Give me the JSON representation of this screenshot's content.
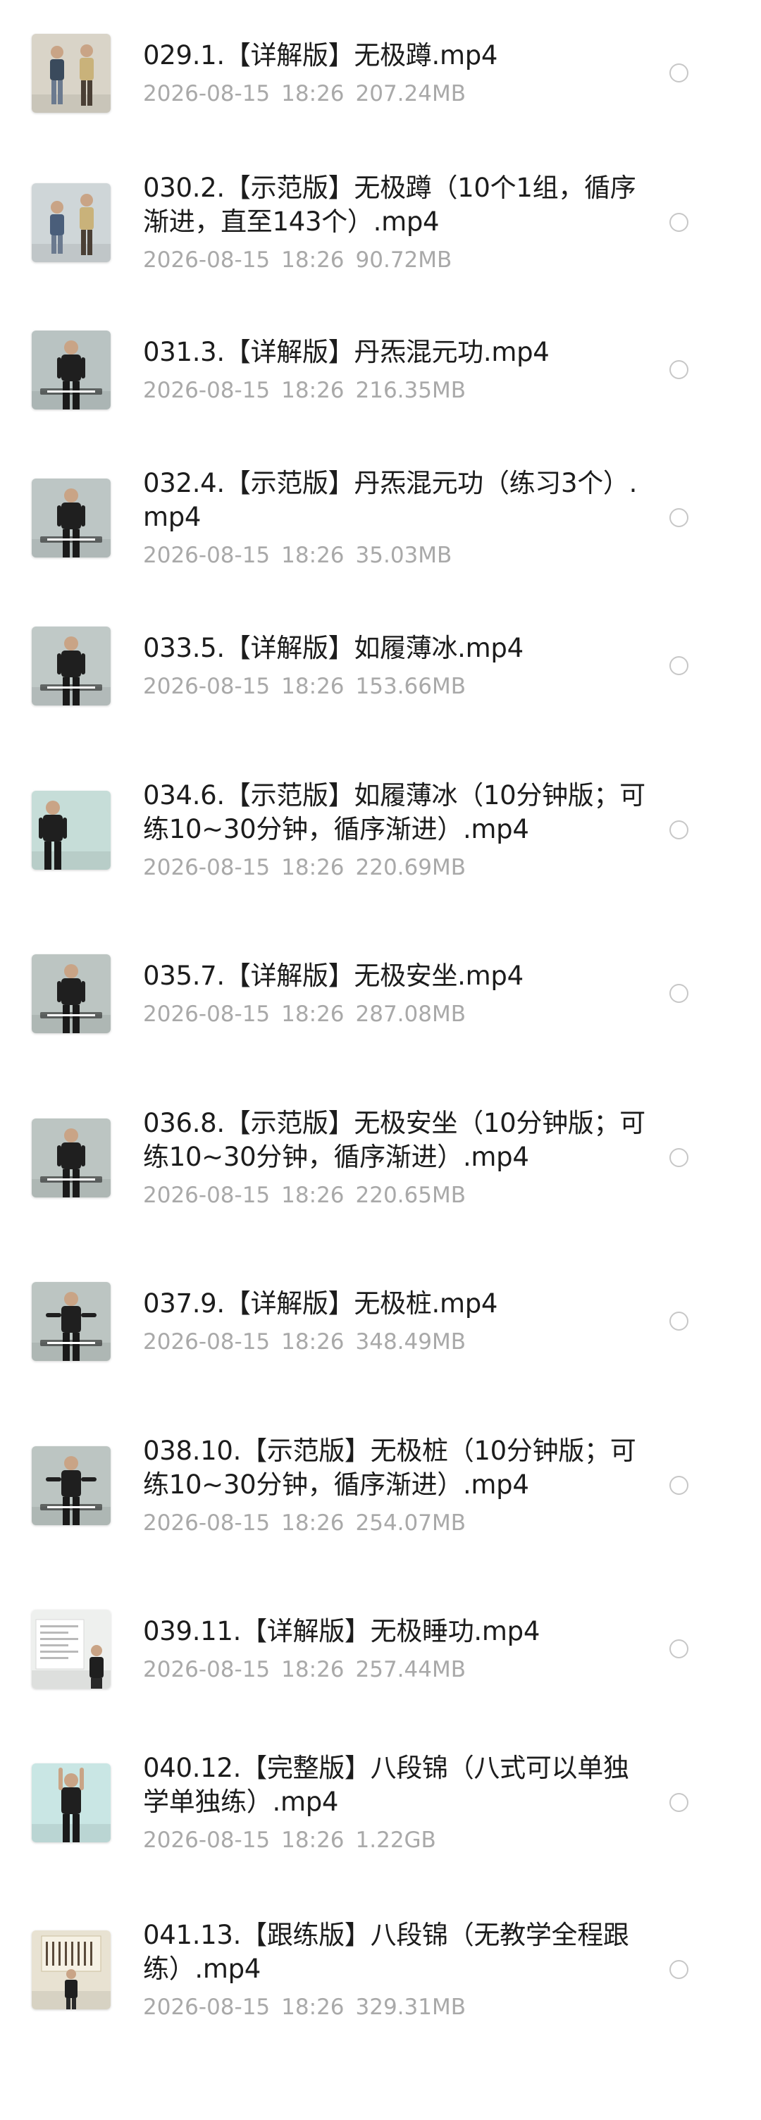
{
  "files": [
    {
      "name": "029.1.【详解版】无极蹲.mp4",
      "date": "2026-08-15",
      "time": "18:26",
      "size": "207.24MB",
      "thumb": {
        "bg": "#d9d4c8",
        "figure": "#3a4a5c",
        "subject": "two-people-standing"
      }
    },
    {
      "name": "030.2.【示范版】无极蹲（10个1组，循序渐进，直至143个）.mp4",
      "date": "2026-08-15",
      "time": "18:26",
      "size": "90.72MB",
      "thumb": {
        "bg": "#cfd6d8",
        "figure": "#4a5e7a",
        "subject": "two-people-squat"
      }
    },
    {
      "name": "031.3.【详解版】丹炁混元功.mp4",
      "date": "2026-08-15",
      "time": "18:26",
      "size": "216.35MB",
      "thumb": {
        "bg": "#b9c3c2",
        "figure": "#1f1f1f",
        "subject": "man-black-shirt"
      }
    },
    {
      "name": "032.4.【示范版】丹炁混元功（练习3个）.mp4",
      "date": "2026-08-15",
      "time": "18:26",
      "size": "35.03MB",
      "thumb": {
        "bg": "#bdc6c5",
        "figure": "#1f1f1f",
        "subject": "man-black-shirt"
      }
    },
    {
      "name": "033.5.【详解版】如履薄冰.mp4",
      "date": "2026-08-15",
      "time": "18:26",
      "size": "153.66MB",
      "thumb": {
        "bg": "#c0c9c7",
        "figure": "#1f1f1f",
        "subject": "man-black-shirt"
      }
    },
    {
      "name": "034.6.【示范版】如履薄冰（10分钟版；可练10~30分钟，循序渐进）.mp4",
      "date": "2026-08-15",
      "time": "18:26",
      "size": "220.69MB",
      "thumb": {
        "bg": "#c6ddd8",
        "figure": "#1f1f1f",
        "subject": "man-side-view"
      }
    },
    {
      "name": "035.7.【详解版】无极安坐.mp4",
      "date": "2026-08-15",
      "time": "18:26",
      "size": "287.08MB",
      "thumb": {
        "bg": "#bcc5c2",
        "figure": "#1f1f1f",
        "subject": "man-seated"
      }
    },
    {
      "name": "036.8.【示范版】无极安坐（10分钟版；可练10~30分钟，循序渐进）.mp4",
      "date": "2026-08-15",
      "time": "18:26",
      "size": "220.65MB",
      "thumb": {
        "bg": "#bcc5c2",
        "figure": "#1f1f1f",
        "subject": "man-seated"
      }
    },
    {
      "name": "037.9.【详解版】无极桩.mp4",
      "date": "2026-08-15",
      "time": "18:26",
      "size": "348.49MB",
      "thumb": {
        "bg": "#bcc5c2",
        "figure": "#1f1f1f",
        "subject": "man-arms-out"
      }
    },
    {
      "name": "038.10.【示范版】无极桩（10分钟版；可练10~30分钟，循序渐进）.mp4",
      "date": "2026-08-15",
      "time": "18:26",
      "size": "254.07MB",
      "thumb": {
        "bg": "#bcc5c2",
        "figure": "#1f1f1f",
        "subject": "man-arms-out"
      }
    },
    {
      "name": "039.11.【详解版】无极睡功.mp4",
      "date": "2026-08-15",
      "time": "18:26",
      "size": "257.44MB",
      "thumb": {
        "bg": "#eef0ee",
        "figure": "#1f1f1f",
        "subject": "slide-with-man"
      }
    },
    {
      "name": "040.12.【完整版】八段锦（八式可以单独学单独练）.mp4",
      "date": "2026-08-15",
      "time": "18:26",
      "size": "1.22GB",
      "thumb": {
        "bg": "#c9e6e4",
        "figure": "#1f1f1f",
        "subject": "man-arms-up"
      }
    },
    {
      "name": "041.13.【跟练版】八段锦（无教学全程跟练）.mp4",
      "date": "2026-08-15",
      "time": "18:26",
      "size": "329.31MB",
      "thumb": {
        "bg": "#e8e2d2",
        "figure": "#1f1f1f",
        "subject": "man-with-calligraphy"
      }
    }
  ]
}
